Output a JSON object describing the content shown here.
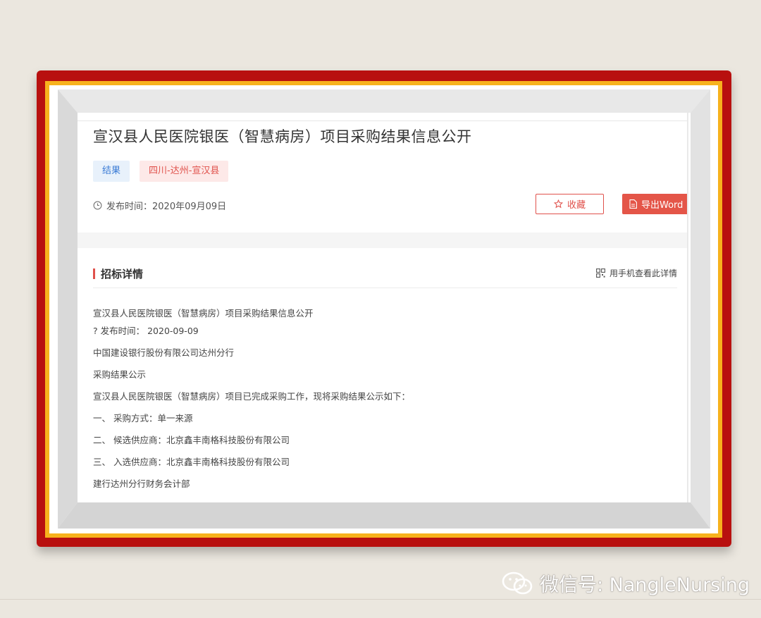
{
  "article": {
    "title": "宣汉县人民医院银医（智慧病房）项目采购结果信息公开",
    "tags": {
      "result": "结果",
      "region": "四川-达州-宣汉县"
    },
    "publish_label": "发布时间：",
    "publish_date": "2020年09月09日",
    "buttons": {
      "favorite": "收藏",
      "export_word": "导出Word"
    }
  },
  "details": {
    "section_title": "招标详情",
    "mobile_view": "用手机查看此详情",
    "lines": [
      "宣汉县人民医院银医（智慧病房）项目采购结果信息公开",
      "? 发布时间： 2020-09-09",
      "中国建设银行股份有限公司达州分行",
      "采购结果公示",
      "宣汉县人民医院银医（智慧病房）项目已完成采购工作，现将采购结果公示如下：",
      "一、 采购方式：单一来源",
      "二、 候选供应商：北京鑫丰南格科技股份有限公司",
      "三、 入选供应商：北京鑫丰南格科技股份有限公司",
      "建行达州分行财务会计部"
    ]
  },
  "watermark": {
    "text": "微信号: NangleNursing"
  },
  "colors": {
    "frame_red": "#b8100f",
    "frame_yellow": "#f7b21d",
    "accent": "#e0514b",
    "tag_blue": "#3a7bd5"
  }
}
